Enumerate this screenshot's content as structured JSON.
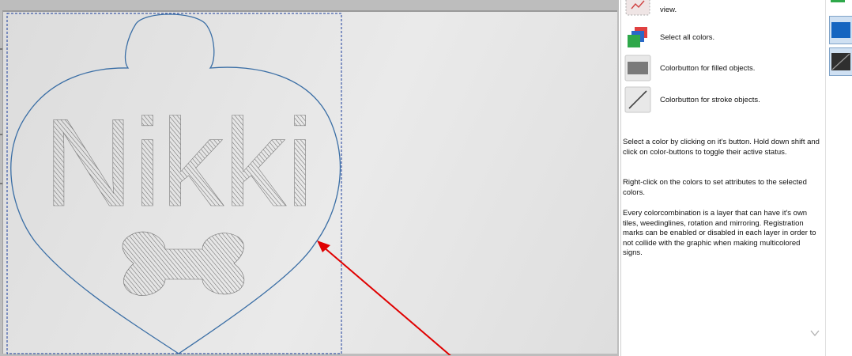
{
  "canvas": {
    "engraved_text": "Nikki"
  },
  "help": {
    "partial_top": "view.",
    "select_all": "Select all colors.",
    "filled": "Colorbutton for filled objects.",
    "stroke": "Colorbutton for stroke objects.",
    "para1": "Select a color by clicking on it's button. Hold down shift and click on color-buttons to toggle their active status.",
    "para2": "Right-click on the colors to set attributes to the selected colors.",
    "para3": "Every colorcombination is a layer that can have it's own tiles, weedinglines, rotation and mirroring. Registration marks can be enabled or disabled in each layer in order to not collide with the graphic when making multicolored signs."
  },
  "colors": {
    "outline": "#3a6ea5",
    "selection": "#1a3d9c",
    "arrow": "#e00000",
    "hatch": "#6e6e6e",
    "accent": "#1565c0"
  },
  "icons": {
    "partial": "marker-icon",
    "select_all": "select-all-colors-icon",
    "filled": "filled-color-icon",
    "stroke": "stroke-color-icon"
  }
}
